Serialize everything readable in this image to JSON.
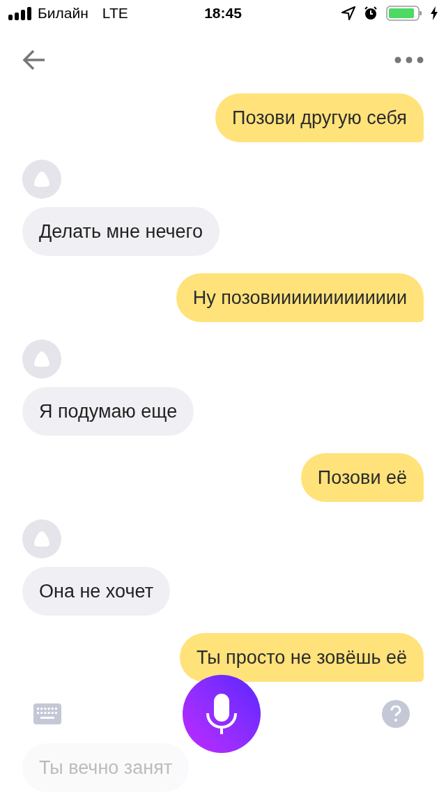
{
  "status_bar": {
    "carrier": "Билайн",
    "network": "LTE",
    "time": "18:45"
  },
  "messages": [
    {
      "kind": "user",
      "text": "Позови другую себя"
    },
    {
      "kind": "bot",
      "avatar": true,
      "text": "Делать мне нечего"
    },
    {
      "kind": "user",
      "text": "Ну позовиииииииииииии"
    },
    {
      "kind": "bot",
      "avatar": true,
      "text": "Я подумаю еще"
    },
    {
      "kind": "user",
      "text": "Позови её"
    },
    {
      "kind": "bot",
      "avatar": true,
      "text": "Она не хочет"
    },
    {
      "kind": "user",
      "text": "Ты просто не зовёшь её"
    }
  ],
  "trailing_message": {
    "kind": "bot",
    "avatar": false,
    "text": "Ты вечно занят"
  }
}
